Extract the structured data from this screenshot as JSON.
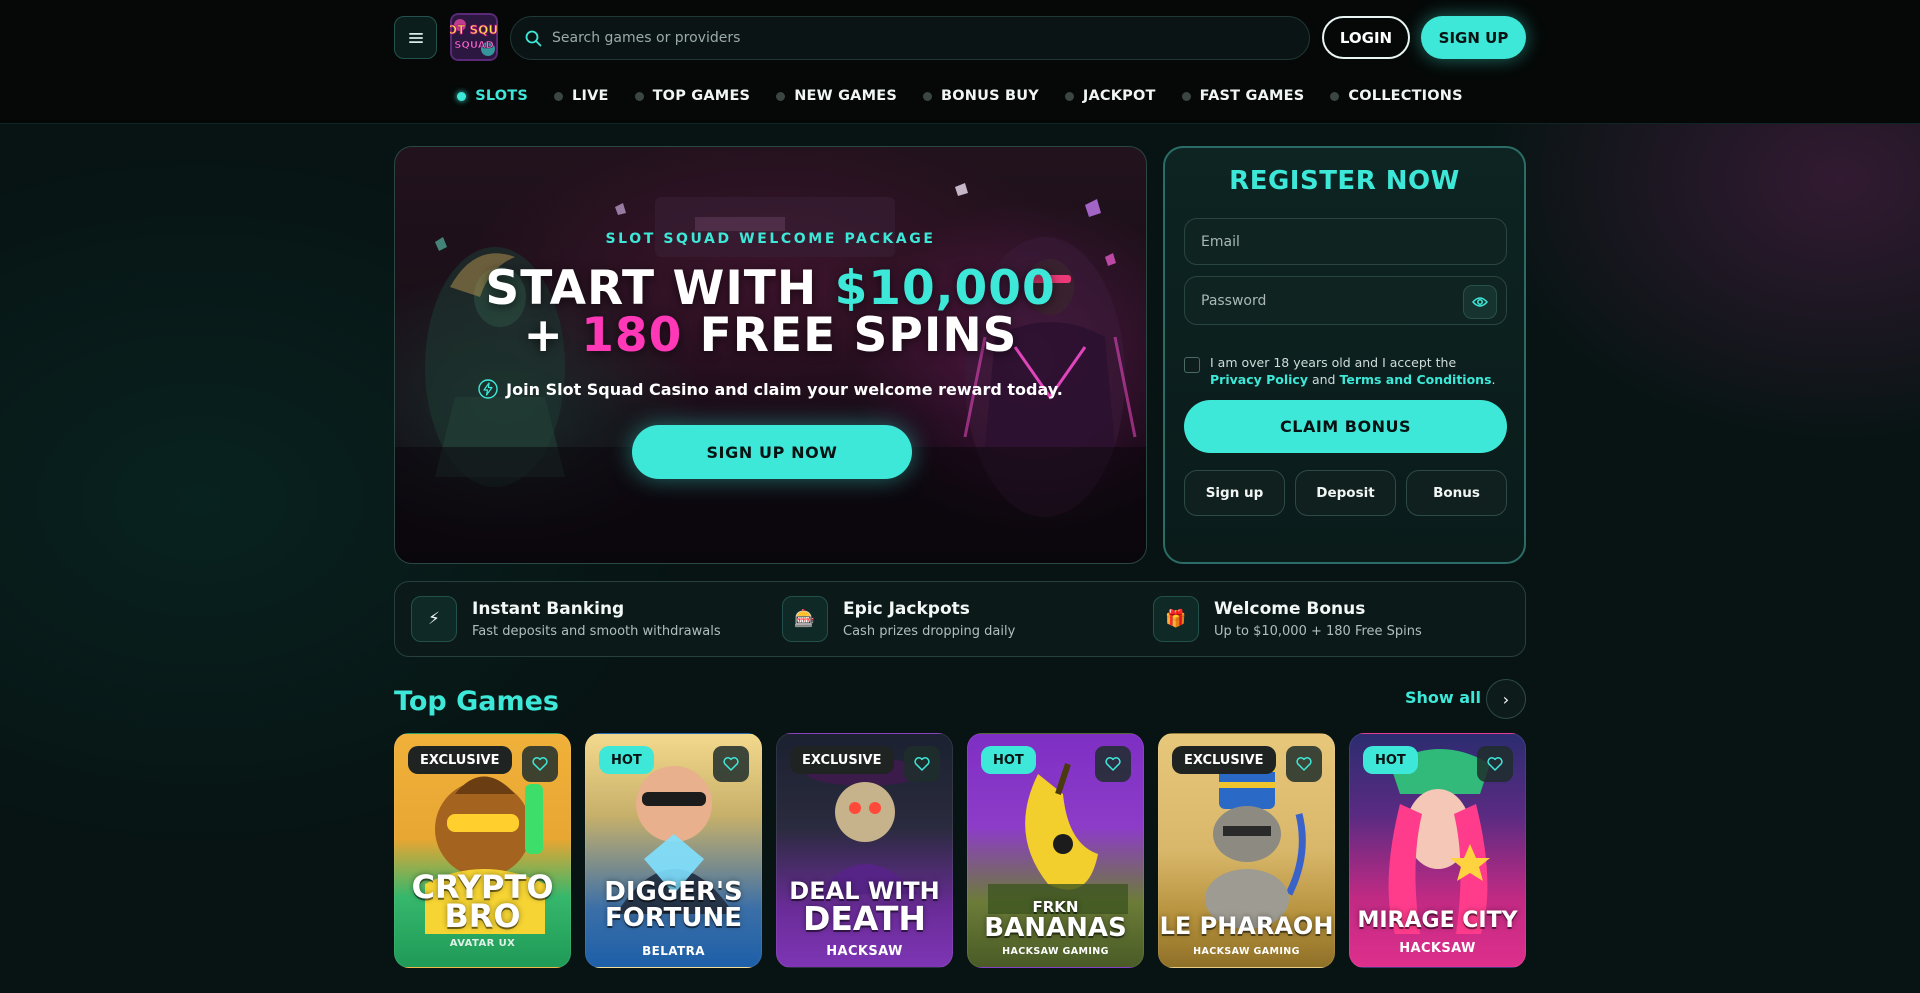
{
  "header": {
    "logo_text": "SLOT SQUAD",
    "search_placeholder": "Search games or providers",
    "login_label": "LOGIN",
    "signup_label": "SIGN UP",
    "accent_color": "#3ee8d8"
  },
  "nav": {
    "items": [
      {
        "label": "SLOTS",
        "active": true
      },
      {
        "label": "LIVE"
      },
      {
        "label": "TOP GAMES"
      },
      {
        "label": "NEW GAMES"
      },
      {
        "label": "BONUS BUY"
      },
      {
        "label": "JACKPOT"
      },
      {
        "label": "FAST GAMES"
      },
      {
        "label": "COLLECTIONS"
      }
    ]
  },
  "hero": {
    "kicker": "SLOT SQUAD WELCOME PACKAGE",
    "title_part1": "START WITH ",
    "title_amount": "$10,000",
    "title_part2": "+ ",
    "title_spins": "180",
    "title_part3": " FREE SPINS",
    "subtitle": "Join Slot Squad Casino and claim your welcome reward today.",
    "cta_label": "SIGN UP NOW"
  },
  "register": {
    "title": "REGISTER NOW",
    "email_placeholder": "Email",
    "password_placeholder": "Password",
    "consent_text": "I am over 18 years old and I accept the",
    "privacy_label": "Privacy Policy",
    "and_text": "and",
    "terms_label": "Terms and Conditions",
    "period": ".",
    "claim_label": "CLAIM BONUS",
    "chips": [
      "Sign up",
      "Deposit",
      "Bonus"
    ]
  },
  "features": [
    {
      "icon": "lightning-icon",
      "glyph": "⚡",
      "title": "Instant Banking",
      "subtitle": "Fast deposits and smooth withdrawals"
    },
    {
      "icon": "slot-machine-icon",
      "glyph": "🎰",
      "title": "Epic Jackpots",
      "subtitle": "Cash prizes dropping daily"
    },
    {
      "icon": "gift-icon",
      "glyph": "🎁",
      "title": "Welcome Bonus",
      "subtitle": "Up to $10,000 + 180 Free Spins"
    }
  ],
  "top_games": {
    "title": "Top Games",
    "show_all_label": "Show all",
    "games": [
      {
        "badge": "EXCLUSIVE",
        "name_line1": "CRYPTO",
        "name_line2": "BRO",
        "provider": "AVATAR UX",
        "colors": [
          "#f2b531",
          "#2db56a"
        ]
      },
      {
        "badge": "HOT",
        "name_line1": "DIGGER'S",
        "name_line2": "FORTUNE",
        "provider": "BELATRA",
        "colors": [
          "#e8c877",
          "#2a6fb0"
        ]
      },
      {
        "badge": "EXCLUSIVE",
        "name_line1": "DEAL WITH",
        "name_line2": "DEATH",
        "provider": "HACKSAW",
        "colors": [
          "#1c2230",
          "#7b2fa8"
        ]
      },
      {
        "badge": "HOT",
        "name_line1": "FRKN",
        "name_line2": "BANANAS",
        "provider": "HACKSAW GAMING",
        "colors": [
          "#8a38c9",
          "#5b6e36"
        ]
      },
      {
        "badge": "EXCLUSIVE",
        "name_line1": "LE PHARAOH",
        "name_line2": "",
        "provider": "HACKSAW GAMING",
        "colors": [
          "#d9b76a",
          "#a5852e"
        ]
      },
      {
        "badge": "HOT",
        "name_line1": "MIRAGE CITY",
        "name_line2": "",
        "provider": "HACKSAW",
        "colors": [
          "#3a2f7a",
          "#d02a86"
        ]
      }
    ]
  }
}
